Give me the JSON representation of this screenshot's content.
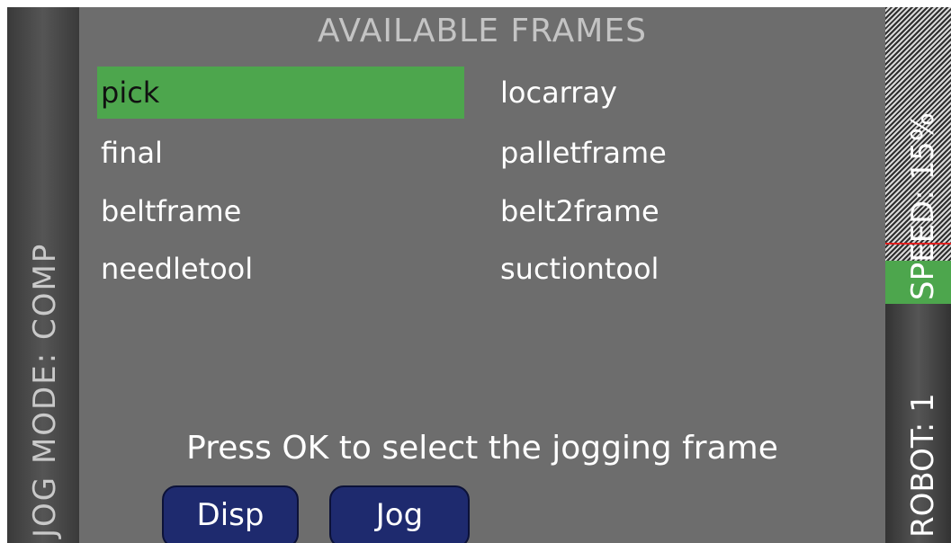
{
  "jog_mode_label": "JOG MODE: COMP",
  "title": "AVAILABLE FRAMES",
  "frames": [
    {
      "label": "pick",
      "selected": true
    },
    {
      "label": "locarray",
      "selected": false
    },
    {
      "label": "final",
      "selected": false
    },
    {
      "label": "palletframe",
      "selected": false
    },
    {
      "label": "beltframe",
      "selected": false
    },
    {
      "label": "belt2frame",
      "selected": false
    },
    {
      "label": "needletool",
      "selected": false
    },
    {
      "label": "suctiontool",
      "selected": false
    }
  ],
  "prompt": "Press OK to select the jogging frame",
  "softkeys": {
    "disp": "Disp",
    "jog": "Jog"
  },
  "speed_label": "SPEED: 15%",
  "speed_percent": 15,
  "robot_label": "ROBOT: 1",
  "colors": {
    "selected": "#4da64d",
    "softkey": "#1e2a6e",
    "background": "#6d6d6d"
  }
}
